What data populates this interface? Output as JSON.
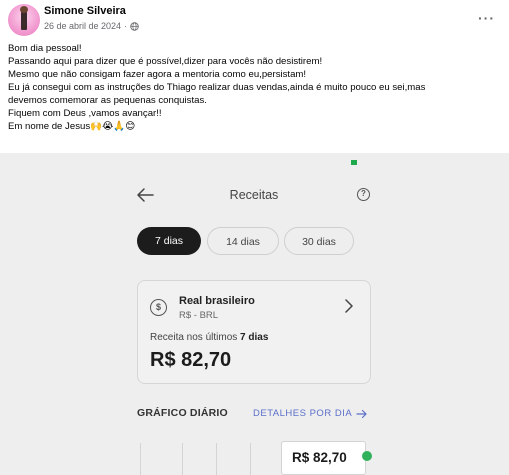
{
  "post": {
    "author": "Simone Silveira",
    "date": "26 de abril de 2024",
    "more_label": "···",
    "lines": [
      "Bom dia pessoal!",
      "Passando aqui para dizer que é possível,dizer para vocês não desistirem!",
      "Mesmo que não consigam fazer agora a mentoria como eu,persistam!",
      "Eu já consegui com as instruções do Thiago realizar duas vendas,ainda é muito pouco eu sei,mas",
      "devemos comemorar as pequenas conquistas.",
      "Fiquem com Deus ,vamos avançar!!",
      "Em nome de Jesus🙌😭🙏😊"
    ]
  },
  "screenshot": {
    "title": "Receitas",
    "help_glyph": "?",
    "periods": [
      "7 dias",
      "14 dias",
      "30 dias"
    ],
    "active_period": "7 dias",
    "currency": {
      "icon_glyph": "$",
      "name": "Real brasileiro",
      "code": "R$ - BRL"
    },
    "revenue_label_prefix": "Receita nos últimos ",
    "revenue_label_period": "7 dias",
    "revenue_value": "R$ 82,70",
    "chart_heading": "GRÁFICO DIÁRIO",
    "details_link": "DETALHES POR DIA",
    "tooltip_value": "R$ 82,70",
    "colors": {
      "accent_green": "#30b15b",
      "link_blue": "#5b6fc9",
      "chip_active": "#1c1c1c"
    }
  }
}
